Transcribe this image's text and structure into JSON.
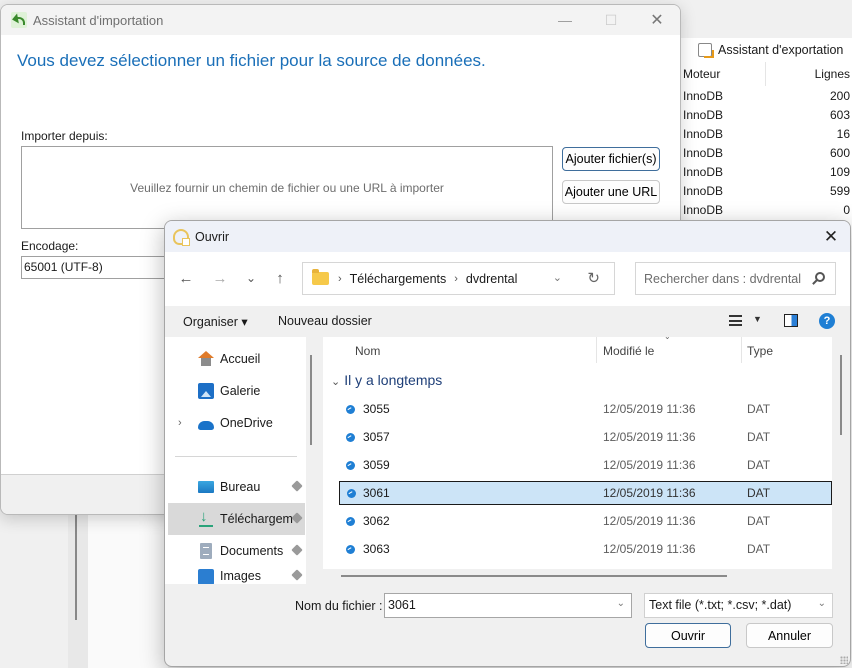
{
  "background_app": {
    "toolbar": {
      "export_wizard_label": "Assistant d'exportation"
    },
    "table": {
      "headers": [
        "Moteur",
        "Lignes"
      ],
      "rows": [
        [
          "InnoDB",
          "200"
        ],
        [
          "InnoDB",
          "603"
        ],
        [
          "InnoDB",
          "16"
        ],
        [
          "InnoDB",
          "600"
        ],
        [
          "InnoDB",
          "109"
        ],
        [
          "InnoDB",
          "599"
        ],
        [
          "InnoDB",
          "0"
        ]
      ]
    }
  },
  "import_wizard": {
    "title": "Assistant d'importation",
    "controls": {
      "minimize": "—",
      "maximize": "☐",
      "close": "✕"
    },
    "heading": "Vous devez sélectionner un fichier pour la source de données.",
    "import_from_label": "Importer depuis:",
    "import_placeholder": "Veuillez fournir un chemin de fichier ou une URL à importer",
    "add_files_button": "Ajouter fichier(s)",
    "add_url_button": "Ajouter une URL",
    "encoding_label": "Encodage:",
    "encoding_value": "65001 (UTF-8)"
  },
  "open_dialog": {
    "title": "Ouvrir",
    "close": "✕",
    "nav": {
      "back": "←",
      "forward": "→",
      "recent": "⌄",
      "up": "↑"
    },
    "breadcrumb": [
      "Téléchargements",
      "dvdrental"
    ],
    "breadcrumb_sep": "›",
    "refresh": "↻",
    "search_placeholder": "Rechercher dans : dvdrental",
    "commands": {
      "organize": "Organiser ▾",
      "new_folder": "Nouveau dossier"
    },
    "view_dropdown": "▼",
    "help": "?",
    "sidebar": {
      "items": [
        {
          "label": "Accueil",
          "icon": "home-icon"
        },
        {
          "label": "Galerie",
          "icon": "gallery-icon"
        },
        {
          "label": "OneDrive",
          "icon": "onedrive-icon",
          "expandable": true
        },
        {
          "label": "Bureau",
          "icon": "desktop-icon",
          "pinned": true
        },
        {
          "label": "Téléchargem",
          "icon": "downloads-icon",
          "pinned": true,
          "selected": true
        },
        {
          "label": "Documents",
          "icon": "documents-icon",
          "pinned": true
        },
        {
          "label": "Images",
          "icon": "images-icon",
          "pinned": true
        }
      ],
      "expand_chevron": "›"
    },
    "file_list": {
      "columns": [
        "Nom",
        "Modifié le",
        "Type"
      ],
      "sort_indicator": "⌄",
      "group_label": "Il y a longtemps",
      "group_chevron": "⌄",
      "rows": [
        {
          "name": "3055",
          "modified": "12/05/2019 11:36",
          "type": "DAT",
          "selected": false
        },
        {
          "name": "3057",
          "modified": "12/05/2019 11:36",
          "type": "DAT",
          "selected": false
        },
        {
          "name": "3059",
          "modified": "12/05/2019 11:36",
          "type": "DAT",
          "selected": false
        },
        {
          "name": "3061",
          "modified": "12/05/2019 11:36",
          "type": "DAT",
          "selected": true
        },
        {
          "name": "3062",
          "modified": "12/05/2019 11:36",
          "type": "DAT",
          "selected": false
        },
        {
          "name": "3063",
          "modified": "12/05/2019 11:36",
          "type": "DAT",
          "selected": false
        }
      ]
    },
    "filename_label": "Nom du fichier :",
    "filename_value": "3061",
    "filetype_value": "Text file (*.txt; *.csv; *.dat)",
    "dropdown_chevron": "⌄",
    "open_button": "Ouvrir",
    "cancel_button": "Annuler"
  }
}
